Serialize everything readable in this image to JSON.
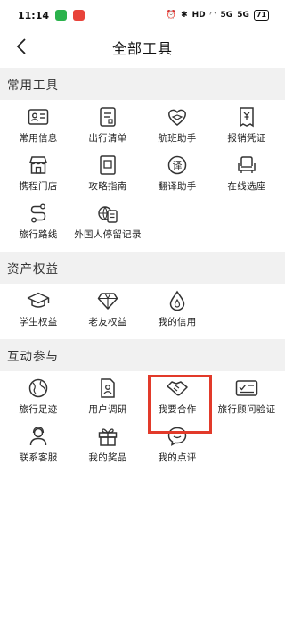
{
  "status_bar": {
    "time": "11:14",
    "battery": "71",
    "signal_labels": [
      "HD",
      "5G",
      "5G"
    ],
    "badge_colors": [
      "#2bb24c",
      "#e8433a"
    ]
  },
  "header": {
    "title": "全部工具"
  },
  "sections": [
    {
      "title": "常用工具",
      "items": [
        {
          "label": "常用信息",
          "icon": "id-card-icon"
        },
        {
          "label": "出行清单",
          "icon": "checklist-icon"
        },
        {
          "label": "航班助手",
          "icon": "heart-plane-icon"
        },
        {
          "label": "报销凭证",
          "icon": "receipt-icon"
        },
        {
          "label": "携程门店",
          "icon": "store-icon"
        },
        {
          "label": "攻略指南",
          "icon": "guide-book-icon"
        },
        {
          "label": "翻译助手",
          "icon": "translate-icon"
        },
        {
          "label": "在线选座",
          "icon": "seat-icon"
        },
        {
          "label": "旅行路线",
          "icon": "route-icon"
        },
        {
          "label": "外国人停留记录",
          "icon": "globe-doc-icon"
        }
      ]
    },
    {
      "title": "资产权益",
      "items": [
        {
          "label": "学生权益",
          "icon": "graduation-cap-icon"
        },
        {
          "label": "老友权益",
          "icon": "diamond-icon"
        },
        {
          "label": "我的信用",
          "icon": "drop-icon"
        }
      ]
    },
    {
      "title": "互动参与",
      "items": [
        {
          "label": "旅行足迹",
          "icon": "globe-icon"
        },
        {
          "label": "用户调研",
          "icon": "survey-icon"
        },
        {
          "label": "我要合作",
          "icon": "handshake-icon"
        },
        {
          "label": "旅行顾问验证",
          "icon": "verify-card-icon"
        },
        {
          "label": "联系客服",
          "icon": "customer-service-icon"
        },
        {
          "label": "我的奖品",
          "icon": "gift-icon"
        },
        {
          "label": "我的点评",
          "icon": "comment-icon"
        }
      ]
    }
  ],
  "colors": {
    "highlight": "#e23a2a",
    "section_bg": "#f1f1f1"
  }
}
